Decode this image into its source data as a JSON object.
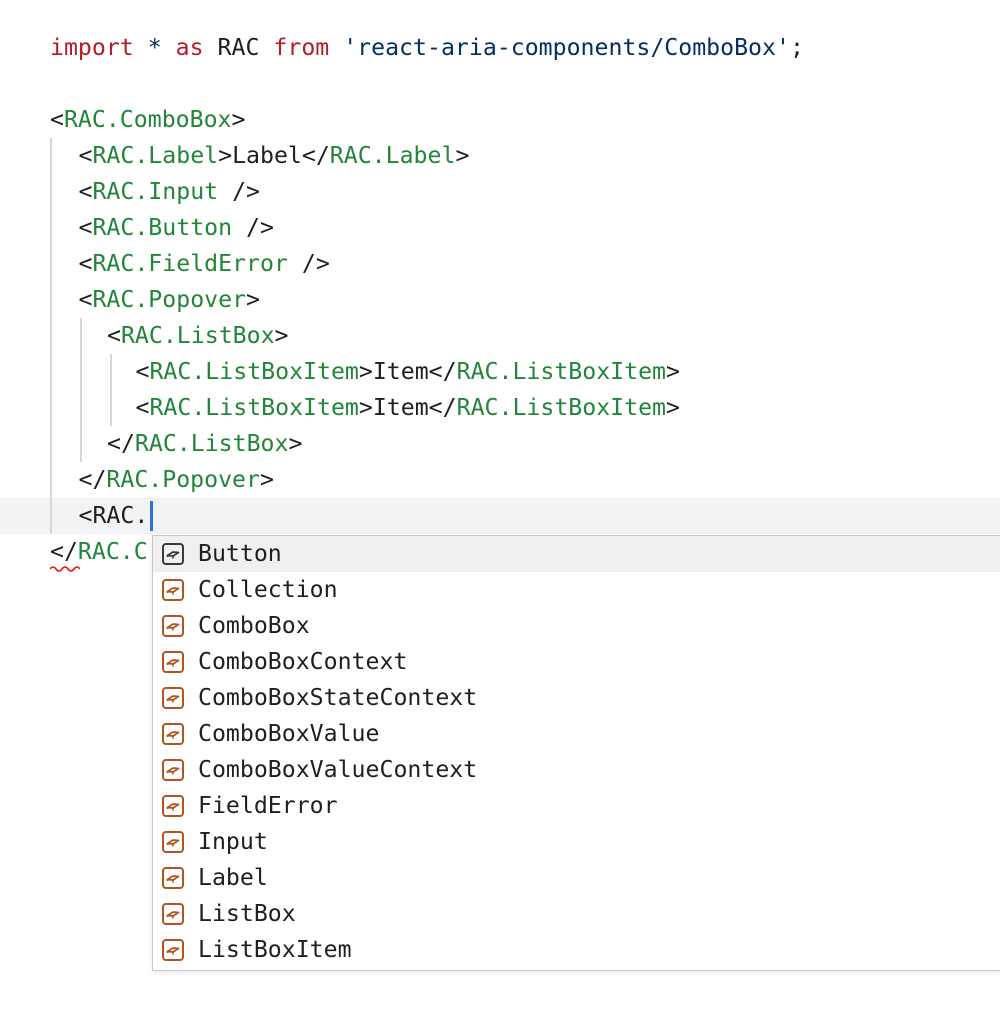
{
  "editor": {
    "lines": [
      {
        "indent": 0,
        "tokens": [
          {
            "t": "import",
            "c": "kw"
          },
          {
            "t": " ",
            "c": "plain"
          },
          {
            "t": "*",
            "c": "str"
          },
          {
            "t": " ",
            "c": "plain"
          },
          {
            "t": "as",
            "c": "kw"
          },
          {
            "t": " RAC ",
            "c": "plain"
          },
          {
            "t": "from",
            "c": "kw"
          },
          {
            "t": " ",
            "c": "plain"
          },
          {
            "t": "'react-aria-components/ComboBox'",
            "c": "str"
          },
          {
            "t": ";",
            "c": "pun"
          }
        ]
      },
      {
        "indent": 0,
        "tokens": []
      },
      {
        "indent": 0,
        "tokens": [
          {
            "t": "<",
            "c": "pun"
          },
          {
            "t": "RAC.ComboBox",
            "c": "tag"
          },
          {
            "t": ">",
            "c": "pun"
          }
        ]
      },
      {
        "indent": 1,
        "tokens": [
          {
            "t": "<",
            "c": "pun"
          },
          {
            "t": "RAC.Label",
            "c": "tag"
          },
          {
            "t": ">Label</",
            "c": "pun"
          },
          {
            "t": "RAC.Label",
            "c": "tag"
          },
          {
            "t": ">",
            "c": "pun"
          }
        ]
      },
      {
        "indent": 1,
        "tokens": [
          {
            "t": "<",
            "c": "pun"
          },
          {
            "t": "RAC.Input",
            "c": "tag"
          },
          {
            "t": " />",
            "c": "pun"
          }
        ]
      },
      {
        "indent": 1,
        "tokens": [
          {
            "t": "<",
            "c": "pun"
          },
          {
            "t": "RAC.Button",
            "c": "tag"
          },
          {
            "t": " />",
            "c": "pun"
          }
        ]
      },
      {
        "indent": 1,
        "tokens": [
          {
            "t": "<",
            "c": "pun"
          },
          {
            "t": "RAC.FieldError",
            "c": "tag"
          },
          {
            "t": " />",
            "c": "pun"
          }
        ]
      },
      {
        "indent": 1,
        "tokens": [
          {
            "t": "<",
            "c": "pun"
          },
          {
            "t": "RAC.Popover",
            "c": "tag"
          },
          {
            "t": ">",
            "c": "pun"
          }
        ]
      },
      {
        "indent": 2,
        "tokens": [
          {
            "t": "<",
            "c": "pun"
          },
          {
            "t": "RAC.ListBox",
            "c": "tag"
          },
          {
            "t": ">",
            "c": "pun"
          }
        ]
      },
      {
        "indent": 3,
        "tokens": [
          {
            "t": "<",
            "c": "pun"
          },
          {
            "t": "RAC.ListBoxItem",
            "c": "tag"
          },
          {
            "t": ">Item</",
            "c": "pun"
          },
          {
            "t": "RAC.ListBoxItem",
            "c": "tag"
          },
          {
            "t": ">",
            "c": "pun"
          }
        ]
      },
      {
        "indent": 3,
        "tokens": [
          {
            "t": "<",
            "c": "pun"
          },
          {
            "t": "RAC.ListBoxItem",
            "c": "tag"
          },
          {
            "t": ">Item</",
            "c": "pun"
          },
          {
            "t": "RAC.ListBoxItem",
            "c": "tag"
          },
          {
            "t": ">",
            "c": "pun"
          }
        ]
      },
      {
        "indent": 2,
        "tokens": [
          {
            "t": "</",
            "c": "pun"
          },
          {
            "t": "RAC.ListBox",
            "c": "tag"
          },
          {
            "t": ">",
            "c": "pun"
          }
        ]
      },
      {
        "indent": 1,
        "tokens": [
          {
            "t": "</",
            "c": "pun"
          },
          {
            "t": "RAC.Popover",
            "c": "tag"
          },
          {
            "t": ">",
            "c": "pun"
          }
        ]
      },
      {
        "indent": 1,
        "current": true,
        "tokens": [
          {
            "t": "<RAC.",
            "c": "plain"
          }
        ]
      },
      {
        "indent": 0,
        "tokens": [
          {
            "t": "</",
            "c": "pun"
          },
          {
            "t": "RAC.C",
            "c": "tag"
          }
        ]
      }
    ]
  },
  "suggest": {
    "icon": "symbol-field-icon",
    "selected_index": 0,
    "items": [
      "Button",
      "Collection",
      "ComboBox",
      "ComboBoxContext",
      "ComboBoxStateContext",
      "ComboBoxValue",
      "ComboBoxValueContext",
      "FieldError",
      "Input",
      "Label",
      "ListBox",
      "ListBoxItem"
    ]
  },
  "colors": {
    "keyword": "#b31d28",
    "string": "#032f62",
    "tag": "#22863a",
    "text": "#1f1f1f",
    "cursor": "#2f6fe0",
    "icon_selected": "#3a3a3a",
    "icon": "#b5541c",
    "error_squiggle": "#e51400"
  }
}
